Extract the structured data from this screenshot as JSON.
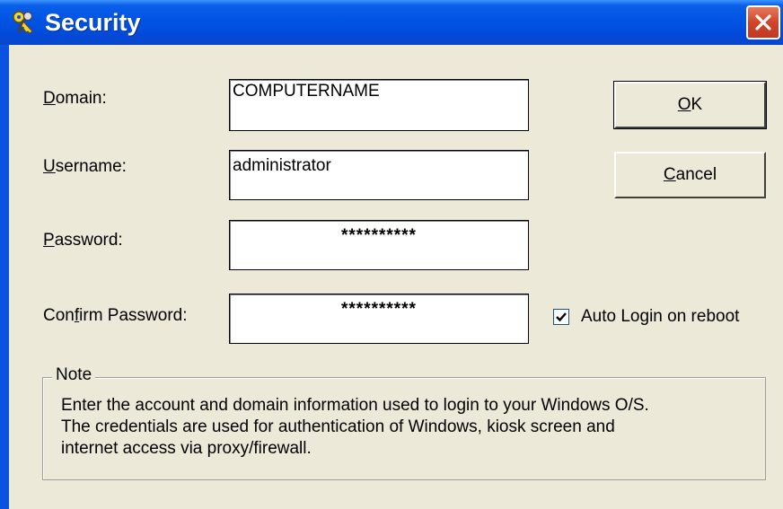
{
  "window": {
    "title": "Security",
    "close_label": "✕"
  },
  "form": {
    "domain": {
      "label_prefix": "",
      "label_key": "D",
      "label_rest": "omain:",
      "value": "COMPUTERNAME"
    },
    "username": {
      "label_prefix": "",
      "label_key": "U",
      "label_rest": "sername:",
      "value": "administrator"
    },
    "password": {
      "label_prefix": "",
      "label_key": "P",
      "label_rest": "assword:",
      "value": "**********"
    },
    "confirm": {
      "label_prefix": "Con",
      "label_key": "f",
      "label_rest": "irm Password:",
      "value": "**********"
    }
  },
  "buttons": {
    "ok": {
      "key": "O",
      "rest": "K"
    },
    "cancel": {
      "key": "C",
      "rest": "ancel"
    }
  },
  "auto_login": {
    "label": "Auto Login on reboot",
    "checked": true
  },
  "note": {
    "legend": "Note",
    "lines": [
      "Enter the account and domain information used to login to your Windows O/S.",
      "The credentials are used for authentication of Windows, kiosk screen and",
      "internet access via proxy/firewall."
    ]
  },
  "colors": {
    "titlebar": "#0054e3",
    "dialog_bg": "#ece9d8",
    "close_button": "#d1442a"
  },
  "icons": {
    "title_icon": "keys-icon",
    "close_icon": "close-icon",
    "checkbox_icon": "checkmark-icon"
  }
}
